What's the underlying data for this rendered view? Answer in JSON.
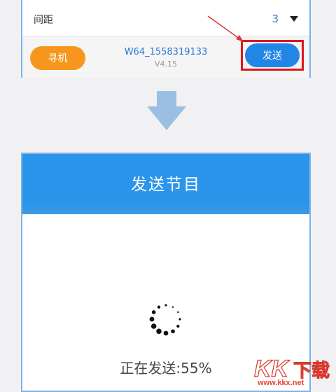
{
  "top_panel": {
    "spacing_label": "间距",
    "spacing_value": "3",
    "find_button_label": "寻机",
    "device_name": "W64_1558319133",
    "device_version": "V4.15",
    "send_button_label": "发送"
  },
  "dialog": {
    "title": "发送节目",
    "progress_label": "正在发送:55%",
    "progress_percent": 55
  },
  "watermark": {
    "logo_text": "KK下载",
    "url": "www.kkx.net"
  },
  "colors": {
    "accent_blue": "#2b95ec",
    "button_blue": "#2186e6",
    "orange": "#f7961d",
    "highlight_red": "#e0161c",
    "arrow_blue": "#9bbfe3"
  }
}
